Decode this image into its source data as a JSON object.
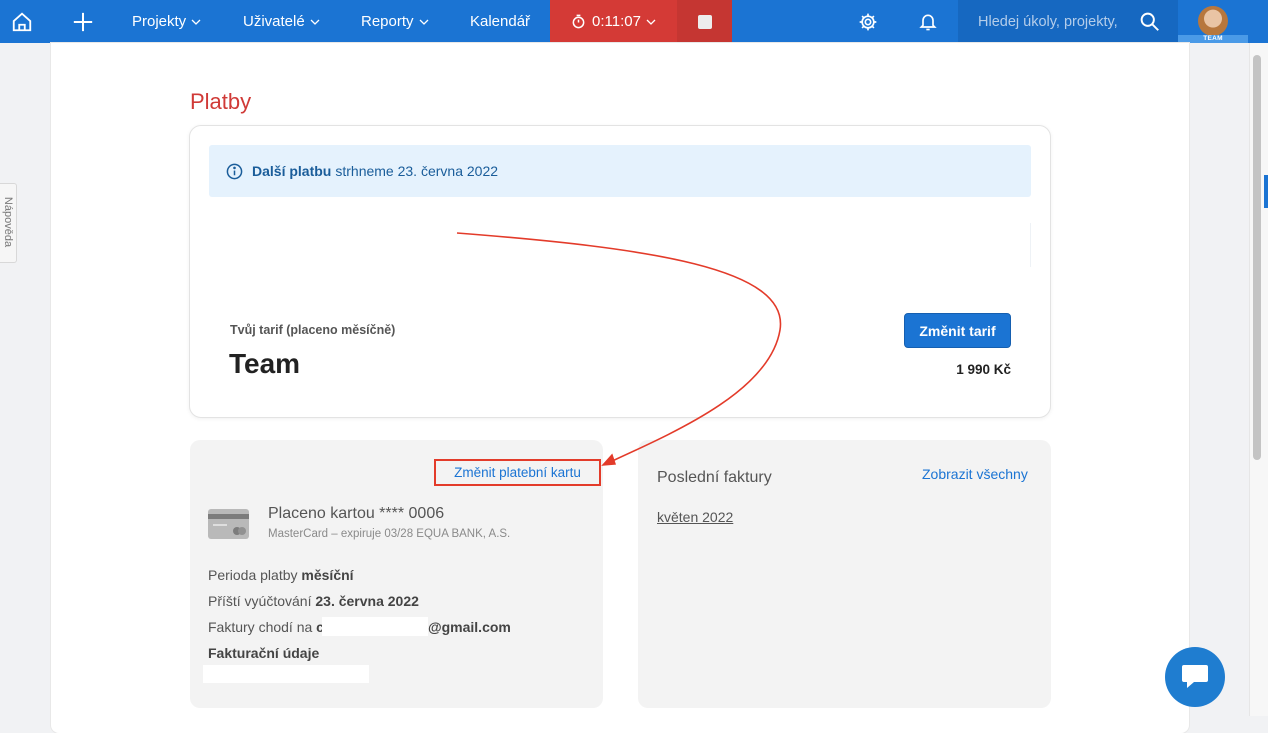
{
  "nav": {
    "projects": "Projekty",
    "users": "Uživatelé",
    "reports": "Reporty",
    "calendar": "Kalendář",
    "timer": "0:11:07",
    "search_placeholder": "Hledej úkoly, projekty,",
    "avatar_badge": "TEAM"
  },
  "sidebar": {
    "help_tab": "Nápověda"
  },
  "page": {
    "title": "Platby"
  },
  "plan": {
    "notice_bold": "Další platbu",
    "notice_text": "strhneme 23. června 2022",
    "tarif_label": "Tvůj tarif (placeno měsíčně)",
    "tarif_name": "Team",
    "change_tarif": "Změnit tarif",
    "price": "1 990 Kč"
  },
  "payment": {
    "change_card": "Změnit platební kartu",
    "paid_title": "Placeno kartou **** 0006",
    "paid_sub": "MasterCard – expiruje 03/28 EQUA BANK, A.S.",
    "period_label": "Perioda platby",
    "period_value": "měsíční",
    "next_label": "Příští vyúčtování",
    "next_value": "23. června 2022",
    "invoices_label": "Faktury chodí na",
    "invoices_email_start": "c",
    "invoices_email_end": "@gmail.com",
    "billing_label": "Fakturační údaje"
  },
  "invoices": {
    "title": "Poslední faktury",
    "show_all": "Zobrazit všechny",
    "items": [
      "květen 2022"
    ]
  },
  "colors": {
    "nav_blue": "#1b74d3",
    "timer_red": "#d43a36",
    "title_red": "#d03a37",
    "annotation_red": "#e33b2a"
  }
}
